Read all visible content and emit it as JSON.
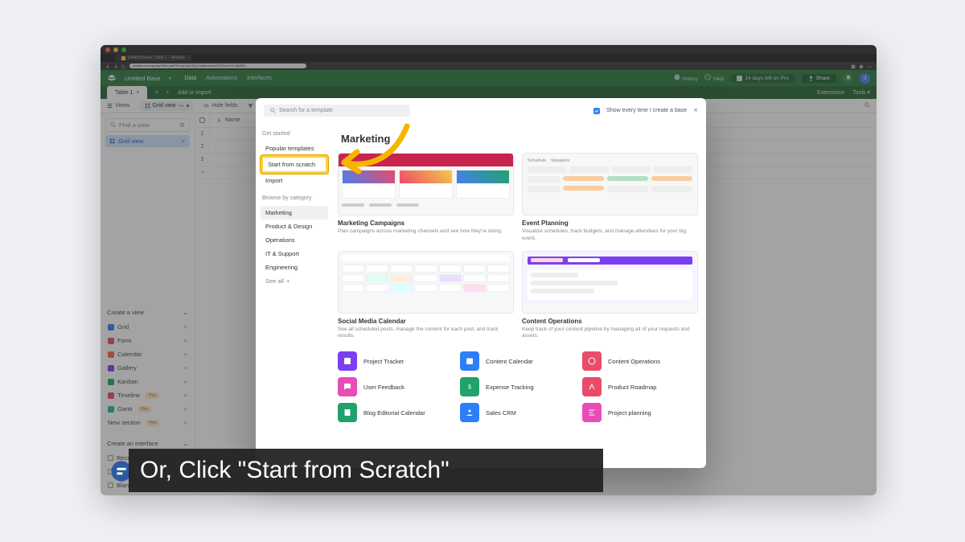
{
  "browser": {
    "tab_title": "Untitled Base: Table 1 – Airtable",
    "url": "airtable.com/app8pVfMnhaaR1f9uaCdxtc3Qz7cpfwcsziosr8ThGvmChCx5jr9f5o"
  },
  "app": {
    "base_name": "Untitled Base",
    "nav": {
      "data": "Data",
      "automations": "Automations",
      "interfaces": "Interfaces"
    },
    "history": "history",
    "help": "Help",
    "trial": "14 days left on Pro",
    "share": "Share",
    "avatar_initial": "J"
  },
  "sub": {
    "table_tab": "Table 1",
    "add_import": "Add or import",
    "extensions": "Extensions",
    "tools": "Tools"
  },
  "toolbar": {
    "views": "Views",
    "grid_view": "Grid view",
    "hide_fields": "Hide fields",
    "filter": "Filter"
  },
  "sidebar": {
    "find_view": "Find a view",
    "grid_view": "Grid view",
    "create_view": "Create a view",
    "types": {
      "grid": "Grid",
      "form": "Form",
      "calendar": "Calendar",
      "gallery": "Gallery",
      "kanban": "Kanban",
      "timeline": "Timeline",
      "gantt": "Gantt",
      "new_section": "New section"
    },
    "pro": "Pro",
    "create_interface": "Create an interface",
    "iface": {
      "record": "Record review",
      "pr": "Pr...",
      "blank": "Blank"
    }
  },
  "grid": {
    "name_header": "Name",
    "rows": [
      "1",
      "2",
      "3"
    ]
  },
  "modal": {
    "search_placeholder": "Search for a template",
    "show_every_time": "Show every time I create a base",
    "left": {
      "get_started": "Get started",
      "popular": "Popular templates",
      "start_scratch": "Start from scratch",
      "import": "Import",
      "browse": "Browse by category",
      "cats": {
        "marketing": "Marketing",
        "product_design": "Product & Design",
        "operations": "Operations",
        "it_support": "IT & Support",
        "engineering": "Engineering"
      },
      "see_all": "See all"
    },
    "right": {
      "title": "Marketing",
      "cards": {
        "mc": {
          "name": "Marketing Campaigns",
          "desc": "Plan campaigns across marketing channels and see how they're doing."
        },
        "ep": {
          "name": "Event Planning",
          "desc": "Visualize schedules, track budgets, and manage attendees for your big event."
        },
        "smc": {
          "name": "Social Media Calendar",
          "desc": "See all scheduled posts, manage the content for each post, and track results."
        },
        "co": {
          "name": "Content Operations",
          "desc": "Keep track of your content pipeline by managing all of your requests and assets."
        }
      },
      "mini": {
        "pt": "Project Tracker",
        "cc": "Content Calendar",
        "cop": "Content Operations",
        "uf": "User Feedback",
        "et": "Expense Tracking",
        "pr": "Product Roadmap",
        "bec": "Blog Editorial Calendar",
        "scrm": "Sales CRM",
        "pp": "Project planning"
      }
    }
  },
  "caption": "Or, Click \"Start from Scratch\""
}
